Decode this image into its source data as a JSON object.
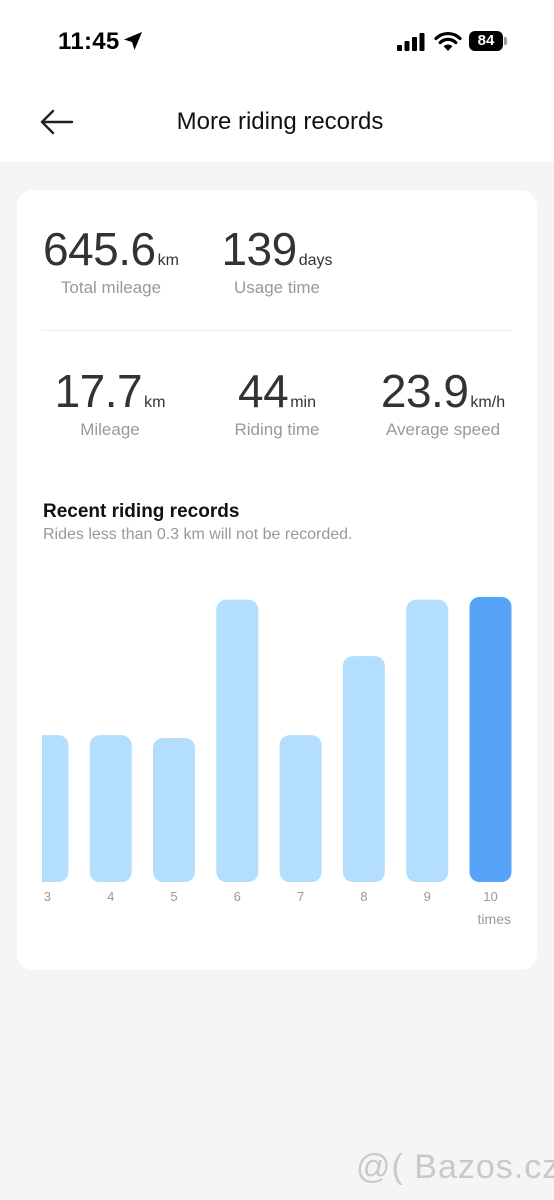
{
  "status": {
    "time": "11:45",
    "battery": "84",
    "icons": [
      "location-arrow-icon",
      "cellular-signal-icon",
      "wifi-icon",
      "battery-icon"
    ]
  },
  "header": {
    "title": "More riding records",
    "back_icon": "back-arrow-icon"
  },
  "totals": {
    "mileage": {
      "value": "645.6",
      "unit": "km",
      "label": "Total mileage"
    },
    "usage": {
      "value": "139",
      "unit": "days",
      "label": "Usage time"
    }
  },
  "last_ride": {
    "mileage": {
      "value": "17.7",
      "unit": "km",
      "label": "Mileage"
    },
    "riding_time": {
      "value": "44",
      "unit": "min",
      "label": "Riding time"
    },
    "avg_speed": {
      "value": "23.9",
      "unit": "km/h",
      "label": "Average speed"
    }
  },
  "recent": {
    "title": "Recent riding records",
    "subtitle": "Rides less than 0.3 km will not be recorded."
  },
  "colors": {
    "bar": "#b3defd",
    "bar_selected": "#56a3f7",
    "tick_text": "#999999"
  },
  "chart_data": {
    "type": "bar",
    "categories": [
      "3",
      "4",
      "5",
      "6",
      "7",
      "8",
      "9",
      "10"
    ],
    "values": [
      5.2,
      5.2,
      5.1,
      10,
      5.2,
      8,
      10,
      10.1
    ],
    "ylim": [
      0,
      10.2
    ],
    "xlabel": "times",
    "ylabel": "",
    "grid": false,
    "selected_index": 7
  },
  "watermark": "@( Bazos.cz"
}
